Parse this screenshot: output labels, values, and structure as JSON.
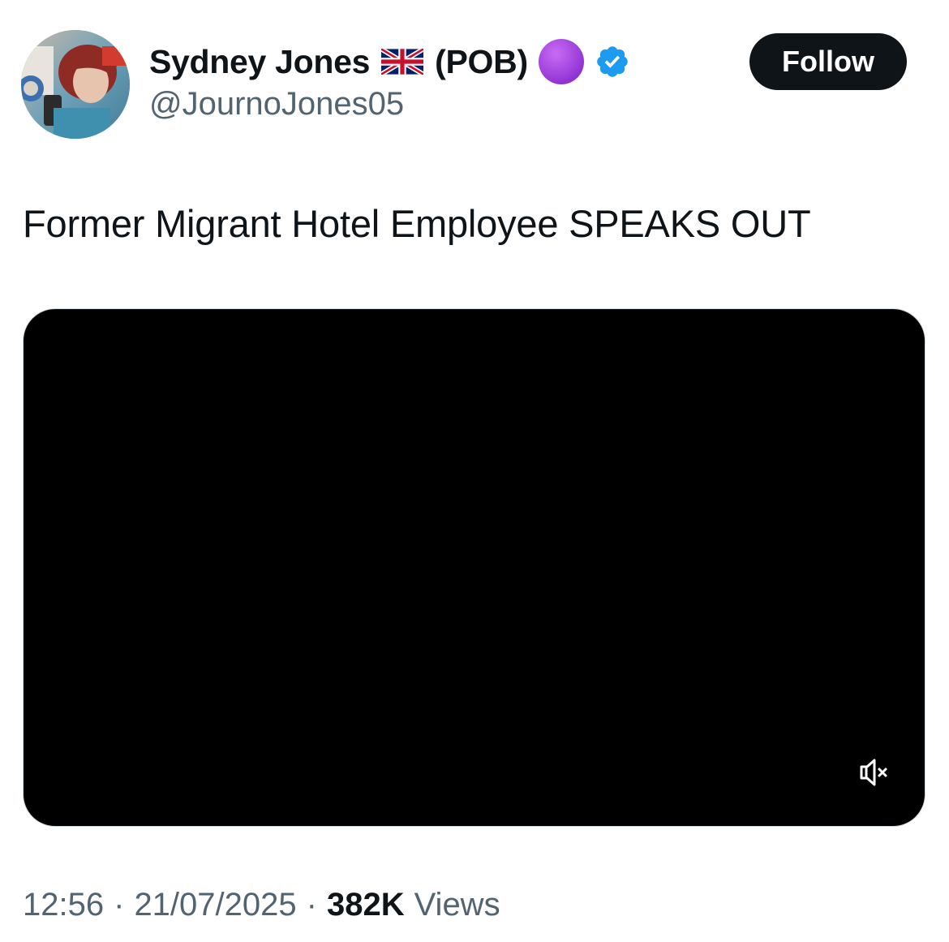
{
  "author": {
    "display_name": "Sydney Jones",
    "name_suffix": "(POB)",
    "handle": "@JournoJones05",
    "flag_icon": "uk-flag-icon",
    "status_icon": "purple-circle-icon",
    "verified_icon": "verified-badge-icon",
    "verified_color": "#1d9bf0"
  },
  "follow_button": {
    "label": "Follow"
  },
  "tweet": {
    "text": "Former Migrant Hotel Employee SPEAKS OUT"
  },
  "video": {
    "muted": true,
    "mute_icon": "speaker-muted-icon"
  },
  "meta": {
    "time": "12:56",
    "date": "21/07/2025",
    "separator": "·",
    "views_count": "382K",
    "views_label": "Views"
  },
  "colors": {
    "text_primary": "#0f1419",
    "text_secondary": "#536471",
    "follow_bg": "#0f1419",
    "purple": "#a743e0"
  }
}
